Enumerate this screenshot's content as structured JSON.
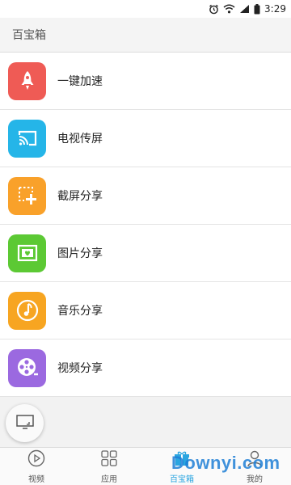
{
  "status_bar": {
    "time": "3:29",
    "icons": [
      "alarm-icon",
      "wifi-icon",
      "signal-icon",
      "battery-icon"
    ]
  },
  "header": {
    "title": "百宝箱"
  },
  "list": {
    "items": [
      {
        "label": "一键加速",
        "icon": "rocket-icon",
        "color": "#ef5b55"
      },
      {
        "label": "电视传屏",
        "icon": "cast-screen-icon",
        "color": "#25b5e8"
      },
      {
        "label": "截屏分享",
        "icon": "screenshot-icon",
        "color": "#f9a12a"
      },
      {
        "label": "图片分享",
        "icon": "picture-icon",
        "color": "#5cc934"
      },
      {
        "label": "音乐分享",
        "icon": "music-note-icon",
        "color": "#f7a521"
      },
      {
        "label": "视频分享",
        "icon": "film-reel-icon",
        "color": "#9b69e0"
      }
    ]
  },
  "floating_button": {
    "icon": "screen-mirror-icon"
  },
  "bottom_nav": {
    "tabs": [
      {
        "label": "视频",
        "icon": "play-circle-icon",
        "active": false
      },
      {
        "label": "应用",
        "icon": "apps-grid-icon",
        "active": false
      },
      {
        "label": "百宝箱",
        "icon": "gift-box-icon",
        "active": true
      },
      {
        "label": "我的",
        "icon": "user-icon",
        "active": false
      }
    ],
    "active_color": "#2aa5e0"
  },
  "watermark": "Downyi.com"
}
